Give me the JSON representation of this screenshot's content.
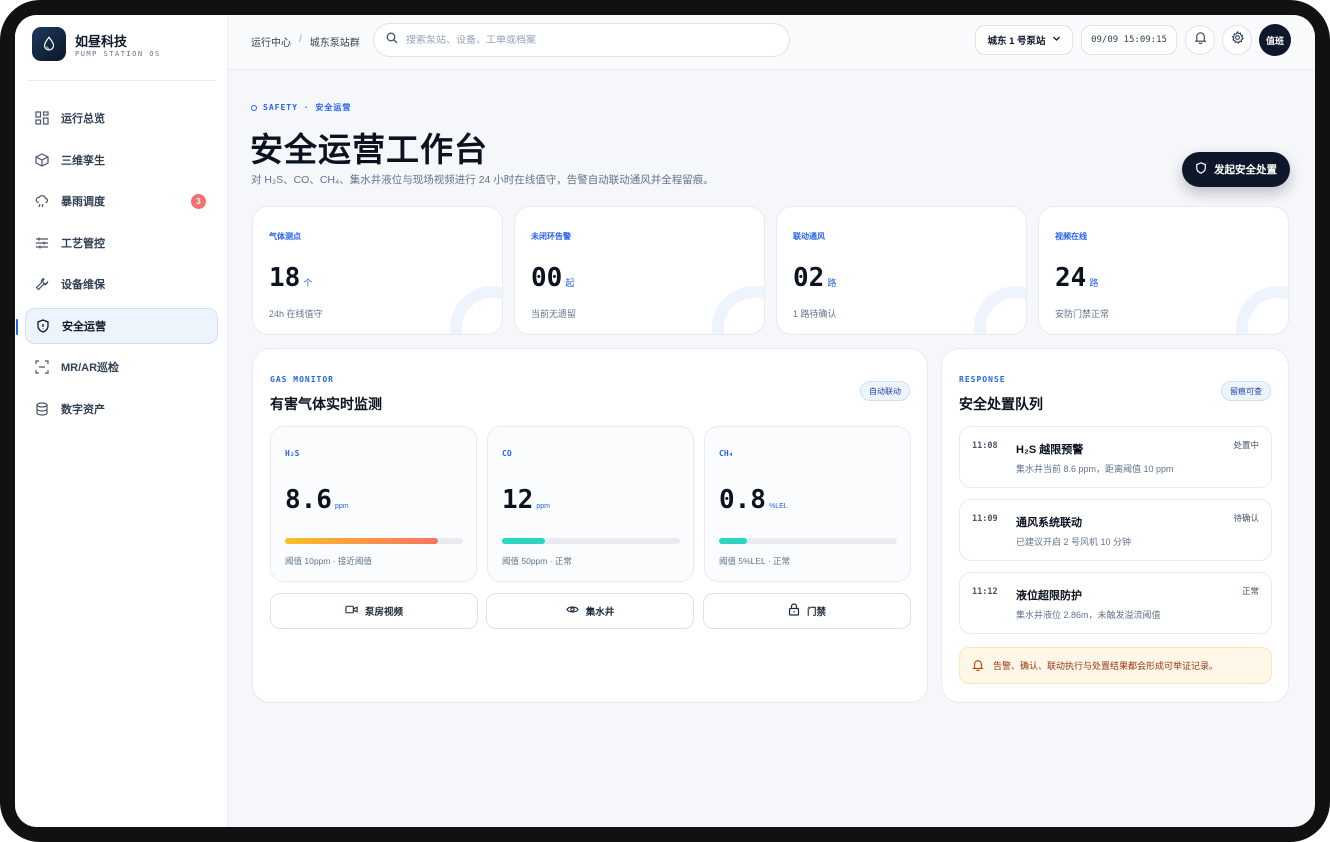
{
  "brand": {
    "name": "如昼科技",
    "subtitle": "PUMP STATION OS"
  },
  "sidebar": {
    "items": [
      {
        "label": "运行总览",
        "icon": "grid-icon"
      },
      {
        "label": "三维孪生",
        "icon": "cube-icon"
      },
      {
        "label": "暴雨调度",
        "icon": "rain-cloud-icon",
        "badge": "3"
      },
      {
        "label": "工艺管控",
        "icon": "sliders-icon"
      },
      {
        "label": "设备维保",
        "icon": "wrench-icon"
      },
      {
        "label": "安全运营",
        "icon": "shield-icon",
        "active": true
      },
      {
        "label": "MR/AR巡检",
        "icon": "scan-icon"
      },
      {
        "label": "数字资产",
        "icon": "database-icon"
      }
    ]
  },
  "topbar": {
    "breadcrumb": [
      "运行中心",
      "城东泵站群"
    ],
    "search_placeholder": "搜索泵站、设备、工单或档案",
    "station": "城东 1 号泵站",
    "datetime": "09/09 15:09:15",
    "avatar": "值班"
  },
  "hero": {
    "eyebrow": "SAFETY · 安全运营",
    "title": "安全运营工作台",
    "description": "对 H₂S、CO、CH₄、集水井液位与现场视频进行 24 小时在线值守，告警自动联动通风并全程留痕。",
    "cta": "发起安全处置"
  },
  "stats": [
    {
      "label": "气体测点",
      "value": "18",
      "unit": "个",
      "sub": "24h 在线值守"
    },
    {
      "label": "未闭环告警",
      "value": "00",
      "unit": "起",
      "sub": "当前无遗留"
    },
    {
      "label": "联动通风",
      "value": "02",
      "unit": "路",
      "sub": "1 路待确认"
    },
    {
      "label": "视频在线",
      "value": "24",
      "unit": "路",
      "sub": "安防门禁正常"
    }
  ],
  "gas_panel": {
    "kicker": "GAS MONITOR",
    "title": "有害气体实时监测",
    "pill": "自动联动",
    "gases": [
      {
        "name": "H₂S",
        "value": "8.6",
        "unit": "ppm",
        "level": 0.86,
        "note": "阈值 10ppm · 接近阈值"
      },
      {
        "name": "CO",
        "value": "12",
        "unit": "ppm",
        "level": 0.24,
        "note": "阈值 50ppm · 正常"
      },
      {
        "name": "CH₄",
        "value": "0.8",
        "unit": "%LEL",
        "level": 0.16,
        "note": "阈值 5%LEL · 正常"
      }
    ],
    "cameras": [
      {
        "label": "泵房视频",
        "icon": "video-camera-icon"
      },
      {
        "label": "集水井",
        "icon": "eye-icon"
      },
      {
        "label": "门禁",
        "icon": "lock-icon"
      }
    ]
  },
  "response": {
    "kicker": "RESPONSE",
    "title": "安全处置队列",
    "pill": "留痕可查",
    "items": [
      {
        "time": "11:08",
        "title": "H₂S 越限预警",
        "desc": "集水井当前 8.6 ppm，距离阈值 10 ppm",
        "status": "处置中"
      },
      {
        "time": "11:09",
        "title": "通风系统联动",
        "desc": "已建议开启 2 号风机 10 分钟",
        "status": "待确认"
      },
      {
        "time": "11:12",
        "title": "液位超限防护",
        "desc": "集水井液位 2.86m，未触发溢流阈值",
        "status": "正常"
      }
    ],
    "notice": "告警、确认、联动执行与处置结果都会形成可举证记录。"
  },
  "colors": {
    "accent": "#2563eb",
    "dark": "#0f172a",
    "h2s_bar": "#f97366",
    "normal_bar": "#2dd4bf",
    "badge": "#f87171"
  }
}
